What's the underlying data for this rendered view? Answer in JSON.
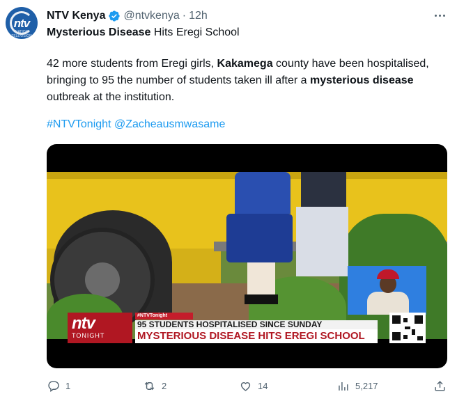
{
  "account": {
    "avatar_text": "ntv",
    "avatar_subtext": "NATION TELEVISION",
    "display_name": "NTV Kenya",
    "handle": "@ntvkenya",
    "separator": "·",
    "time": "12h",
    "verified": true
  },
  "headline": {
    "bold": "Mysterious Disease",
    "rest": " Hits Eregi School"
  },
  "body": {
    "p1": "42 more students from Eregi girls, ",
    "p2": "Kakamega",
    "p3": " county have been hospitalised, bringing to 95 the number of students taken ill after a ",
    "p4": "mysterious disease",
    "p5": " outbreak at the institution."
  },
  "hashtags": {
    "tag1": "#NTVTonight",
    "mention": "@Zacheausmwasame"
  },
  "video_overlay": {
    "logo": "ntv",
    "logo_sub": "TONIGHT",
    "tag": "#NTVTonight",
    "line1": "95 STUDENTS HOSPITALISED SINCE SUNDAY",
    "line2": "MYSTERIOUS DISEASE HITS EREGI SCHOOL"
  },
  "actions": {
    "replies": "1",
    "reposts": "2",
    "likes": "14",
    "views": "5,217"
  },
  "icons": {
    "more": "more-icon",
    "reply": "reply-icon",
    "repost": "repost-icon",
    "like": "heart-icon",
    "views": "views-icon",
    "share": "share-icon",
    "verified": "verified-badge-icon"
  },
  "colors": {
    "link": "#1d9bf0",
    "verified": "#1d9bf0",
    "muted": "#536471"
  }
}
